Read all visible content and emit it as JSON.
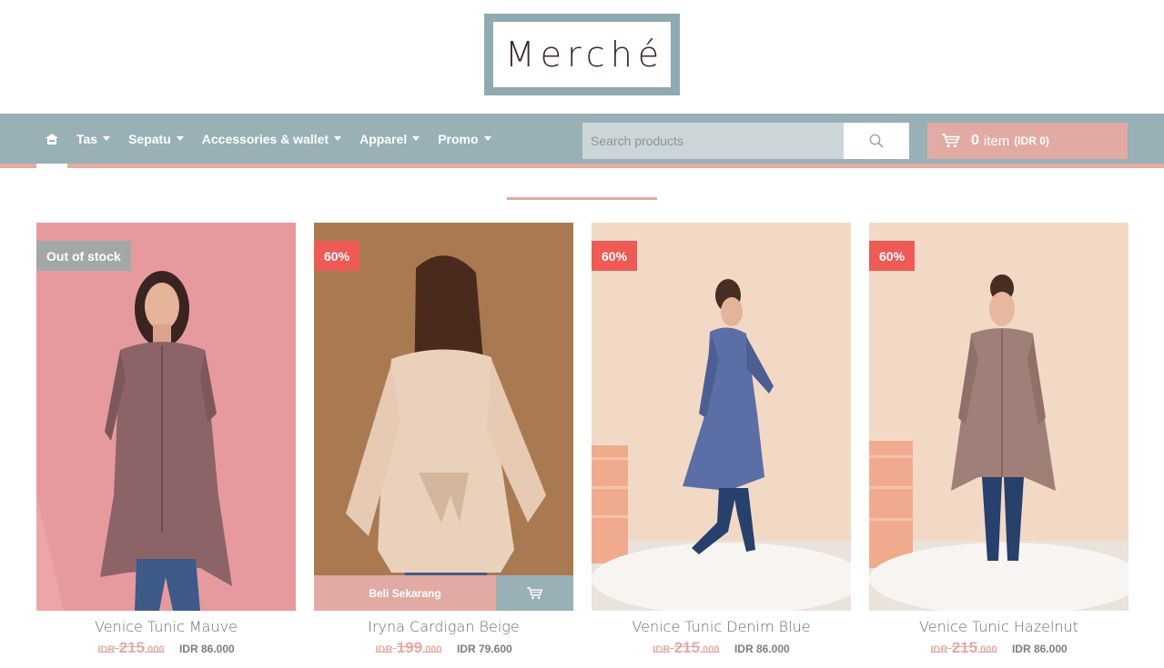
{
  "brand": {
    "logo_text": "Merché",
    "frame_color": "#8faab0"
  },
  "nav": {
    "home_icon": "home-icon",
    "items": [
      {
        "label": "Tas"
      },
      {
        "label": "Sepatu"
      },
      {
        "label": "Accessories & wallet"
      },
      {
        "label": "Apparel"
      },
      {
        "label": "Promo"
      }
    ],
    "bar_color": "#98b0b6",
    "accent_color": "#e4aaa4"
  },
  "search": {
    "placeholder": "Search products",
    "value": "",
    "icon": "search-icon"
  },
  "cart": {
    "icon": "cart-icon",
    "count": "0",
    "label": "item",
    "total": "(IDR 0)"
  },
  "products": [
    {
      "name": "Venice Tunic Mauve",
      "badge": "Out of stock",
      "badge_type": "oos",
      "old_currency": "IDR",
      "old_main": "215",
      "old_decimal": ".000",
      "new_price": "IDR 86.000"
    },
    {
      "name": "Iryna Cardigan Beige",
      "badge": "60%",
      "badge_type": "sale",
      "old_currency": "IDR",
      "old_main": "199",
      "old_decimal": ".000",
      "new_price": "IDR 79.600",
      "buy_now_label": "Beli Sekarang"
    },
    {
      "name": "Venice Tunic Denim Blue",
      "badge": "60%",
      "badge_type": "sale",
      "old_currency": "IDR",
      "old_main": "215",
      "old_decimal": ".000",
      "new_price": "IDR 86.000"
    },
    {
      "name": "Venice Tunic Hazelnut",
      "badge": "60%",
      "badge_type": "sale",
      "old_currency": "IDR",
      "old_main": "215",
      "old_decimal": ".000",
      "new_price": "IDR 86.000"
    }
  ]
}
